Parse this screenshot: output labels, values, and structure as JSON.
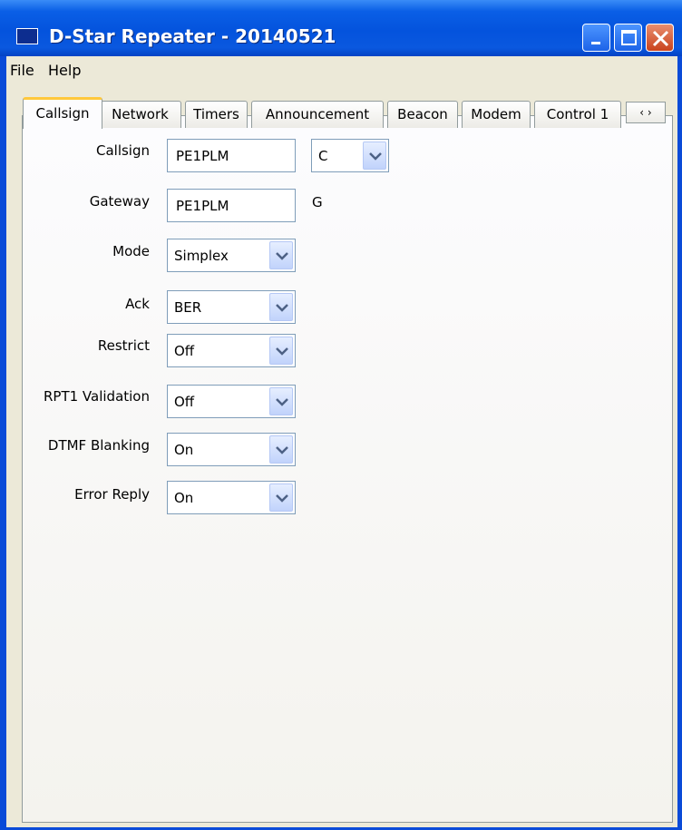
{
  "window": {
    "title": "D-Star Repeater - 20140521"
  },
  "menu": [
    "File",
    "Help"
  ],
  "tabs": [
    "Callsign",
    "Network",
    "Timers",
    "Announcement",
    "Beacon",
    "Modem",
    "Control 1"
  ],
  "tab_scroll": "‹ ›",
  "form": {
    "callsign": {
      "label": "Callsign",
      "value": "PE1PLM",
      "suffix": "C"
    },
    "gateway": {
      "label": "Gateway",
      "value": "PE1PLM",
      "suffix": "G"
    },
    "mode": {
      "label": "Mode",
      "value": "Simplex"
    },
    "ack": {
      "label": "Ack",
      "value": "BER"
    },
    "restrict": {
      "label": "Restrict",
      "value": "Off"
    },
    "rpt1": {
      "label": "RPT1 Validation",
      "value": "Off"
    },
    "dtmf": {
      "label": "DTMF Blanking",
      "value": "On"
    },
    "error": {
      "label": "Error Reply",
      "value": "On"
    }
  },
  "colors": {
    "titlebar": "#0453dd",
    "client": "#ece9d8",
    "active_tab_accent": "#ffc83c"
  },
  "icons": [
    "window-icon",
    "minimize-icon",
    "maximize-icon",
    "close-icon",
    "chevron-down-icon"
  ]
}
